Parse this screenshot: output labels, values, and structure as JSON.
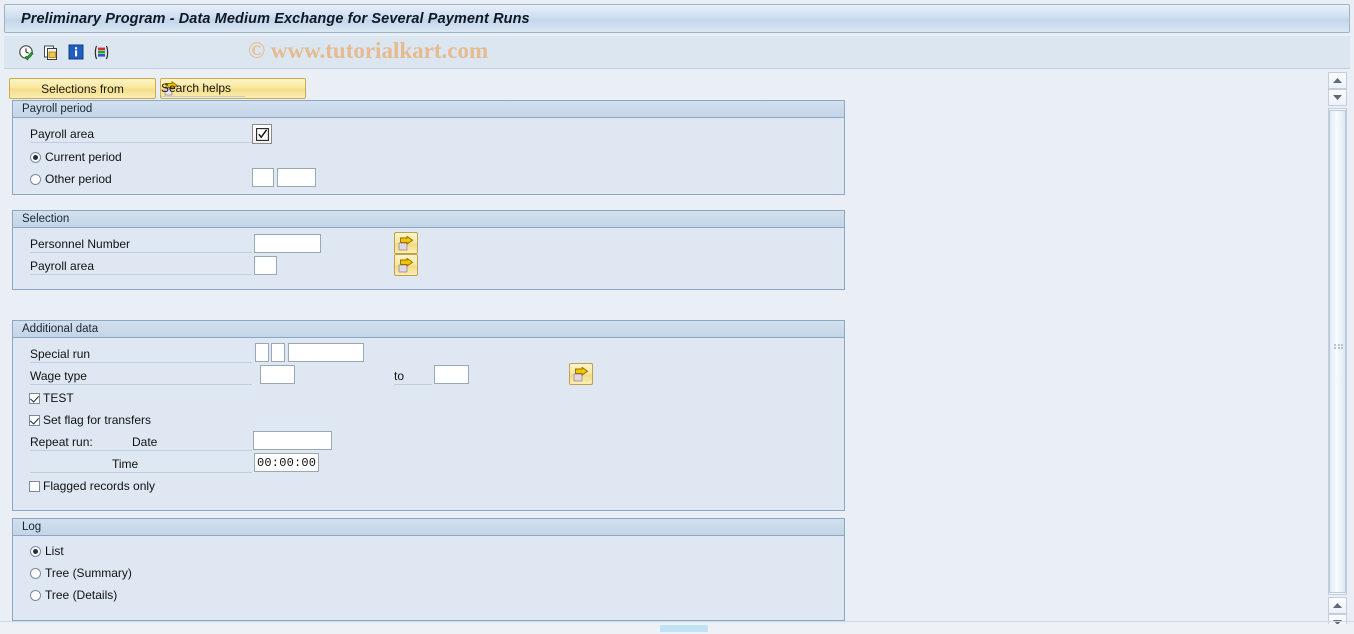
{
  "window": {
    "title": "Preliminary Program - Data Medium Exchange for Several Payment Runs"
  },
  "toolbar": {
    "icons": [
      {
        "name": "execute-clock-icon",
        "glyph": "clock-check"
      },
      {
        "name": "copy-variant-icon",
        "glyph": "copy"
      },
      {
        "name": "info-icon",
        "glyph": "info"
      },
      {
        "name": "color-bars-icon",
        "glyph": "bars"
      }
    ],
    "watermark": "© www.tutorialkart.com"
  },
  "buttons": {
    "selections_from": "Selections from",
    "search_helps": "Search helps"
  },
  "groups": {
    "payroll_period": {
      "title": "Payroll period",
      "payroll_area_label": "Payroll area",
      "payroll_area_value": "",
      "current_period_label": "Current period",
      "other_period_label": "Other period",
      "selected_option": "current",
      "other_period_value_1": "",
      "other_period_value_2": ""
    },
    "selection": {
      "title": "Selection",
      "personnel_number_label": "Personnel Number",
      "personnel_number_value": "",
      "payroll_area_label": "Payroll area",
      "payroll_area_value": ""
    },
    "additional_data": {
      "title": "Additional data",
      "special_run_label": "Special run",
      "special_run_value_1": "",
      "special_run_value_2": "",
      "special_run_value_3": "",
      "wage_type_label": "Wage type",
      "wage_type_from": "",
      "wage_type_to_label": "to",
      "wage_type_to": "",
      "test_label": "TEST",
      "test_checked": true,
      "set_flag_label": "Set flag for transfers",
      "set_flag_checked": true,
      "repeat_run_label": "Repeat run:",
      "date_label": "Date",
      "date_value": "",
      "time_label": "Time",
      "time_value": "00:00:00",
      "flagged_records_label": "Flagged records only",
      "flagged_records_checked": false
    },
    "log": {
      "title": "Log",
      "list_label": "List",
      "tree_summary_label": "Tree (Summary)",
      "tree_details_label": "Tree (Details)",
      "selected_option": "list"
    }
  },
  "colors": {
    "accent_blue": "#8ca7c4",
    "group_bg": "#dfe8f2",
    "page_bg": "#eaeff5",
    "button_yellow": "#f8e79a",
    "watermark": "#e6b98a",
    "hscroll_thumb": "#bfe3f2"
  }
}
